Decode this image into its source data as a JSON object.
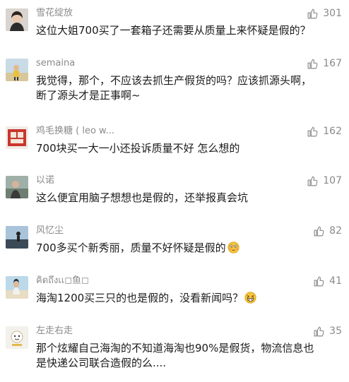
{
  "comments": [
    {
      "user": "雪花绽放",
      "likes": "301",
      "text": "这位大姐700买了一套箱子还需要从质量上来怀疑是假的？"
    },
    {
      "user": "semaina",
      "likes": "167",
      "text_lines": [
        "我觉得，那个，不应该去抓生产假货的吗？应该抓源头啊，",
        "断了源头才是正事啊~"
      ]
    },
    {
      "user": "鸡毛换糖 ( leo w...",
      "likes": "162",
      "text": "700块买一大一小还投诉质量不好 怎么想的"
    },
    {
      "user": "以诺",
      "likes": "107",
      "text": "这么便宜用脑子想想也是假的，还举报真会坑"
    },
    {
      "user": "风忆尘",
      "likes": "82",
      "text": "700多买个新秀丽，质量不好怀疑是假的",
      "emoji": "flushed-face-icon"
    },
    {
      "user": "คิดถึงเเ◻鱼◻",
      "likes": "41",
      "text": "海淘1200买三只的也是假的，没看新闻吗？",
      "emoji": "grinning-face-icon"
    },
    {
      "user": "左走右走",
      "likes": "35",
      "text_lines": [
        "那个炫耀自己海淘的不知道海淘也90%是假货，物流信息也",
        "是快递公司联合造假的么...."
      ]
    }
  ],
  "icons": {
    "like": "thumbs-up-icon"
  },
  "colors": {
    "meta_text": "#8a8a8a",
    "body_text": "#1a1a1a"
  }
}
